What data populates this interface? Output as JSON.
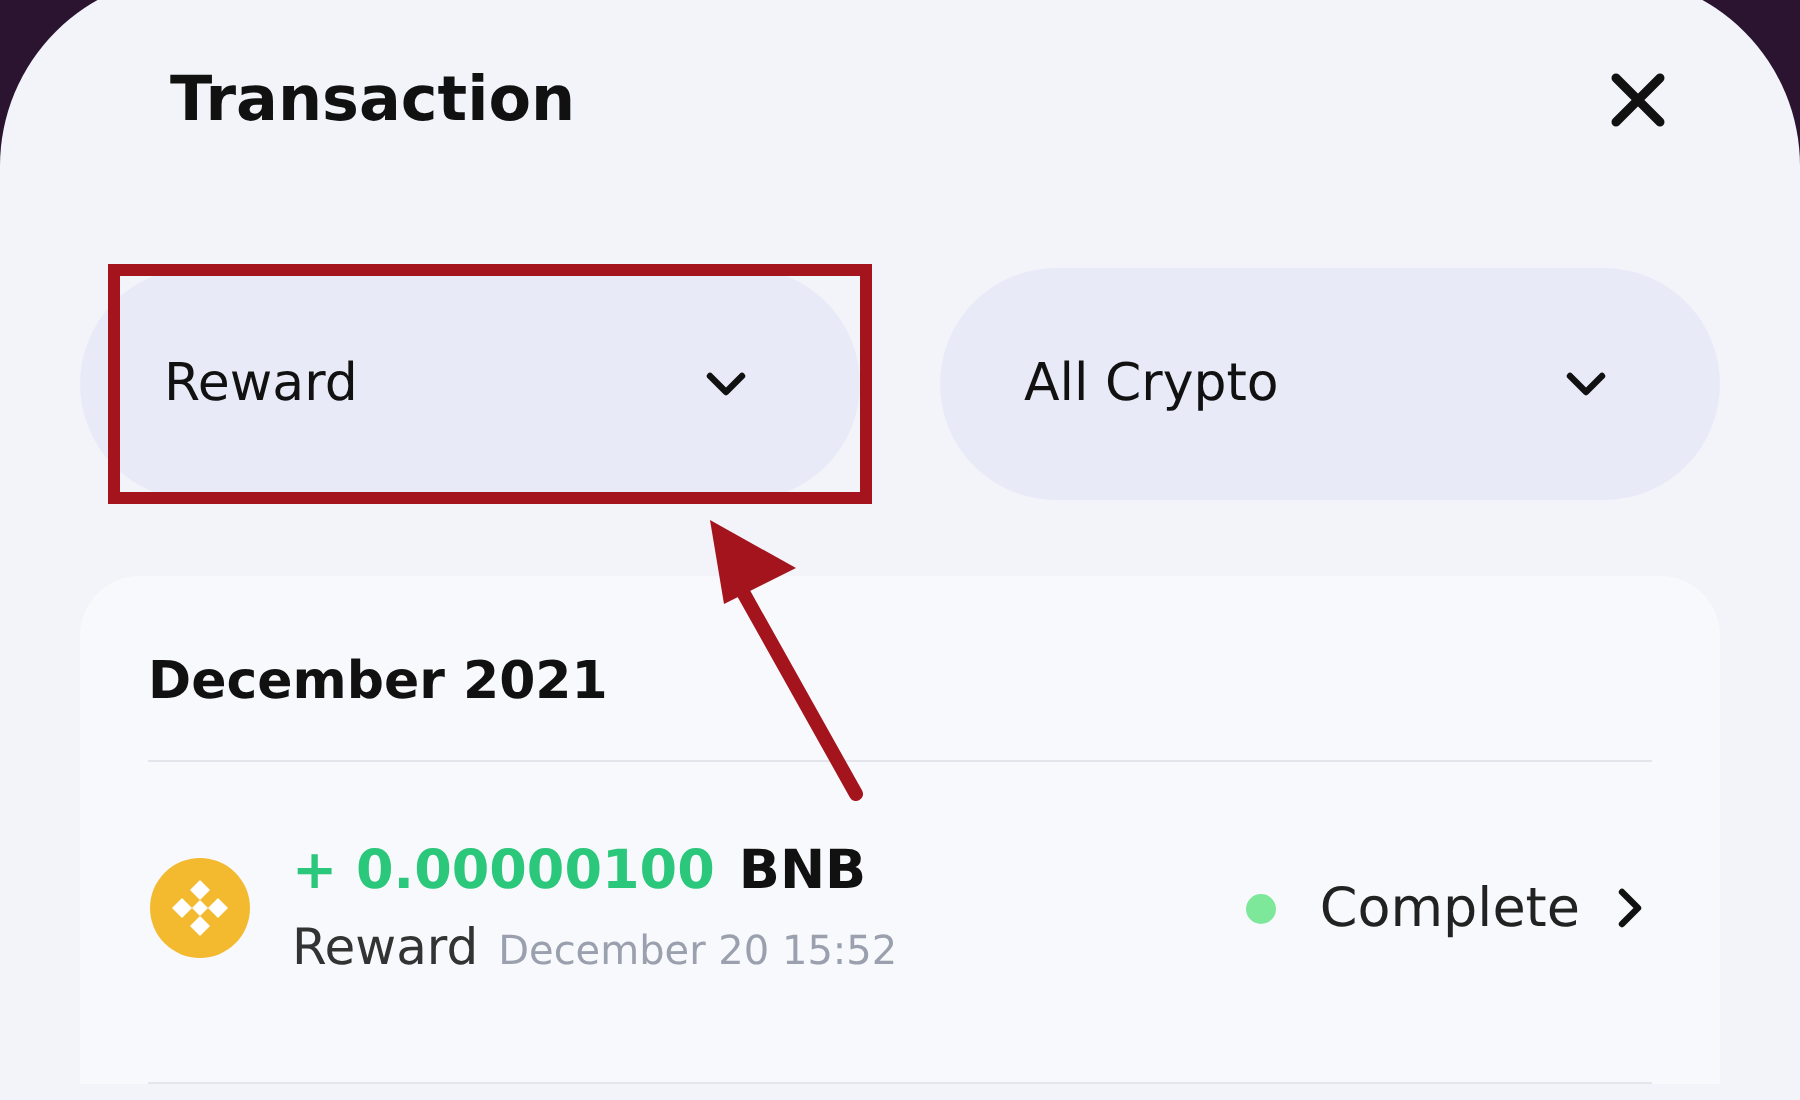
{
  "title": "Transaction",
  "filters": [
    {
      "label": "Reward",
      "highlighted": true
    },
    {
      "label": "All Crypto",
      "highlighted": false
    }
  ],
  "section": {
    "heading": "December 2021",
    "transactions": [
      {
        "amount": "+ 0.00000100",
        "asset": "BNB",
        "type": "Reward",
        "time": "December 20 15:52",
        "status": "Complete",
        "color": "#7ee89a"
      }
    ]
  }
}
